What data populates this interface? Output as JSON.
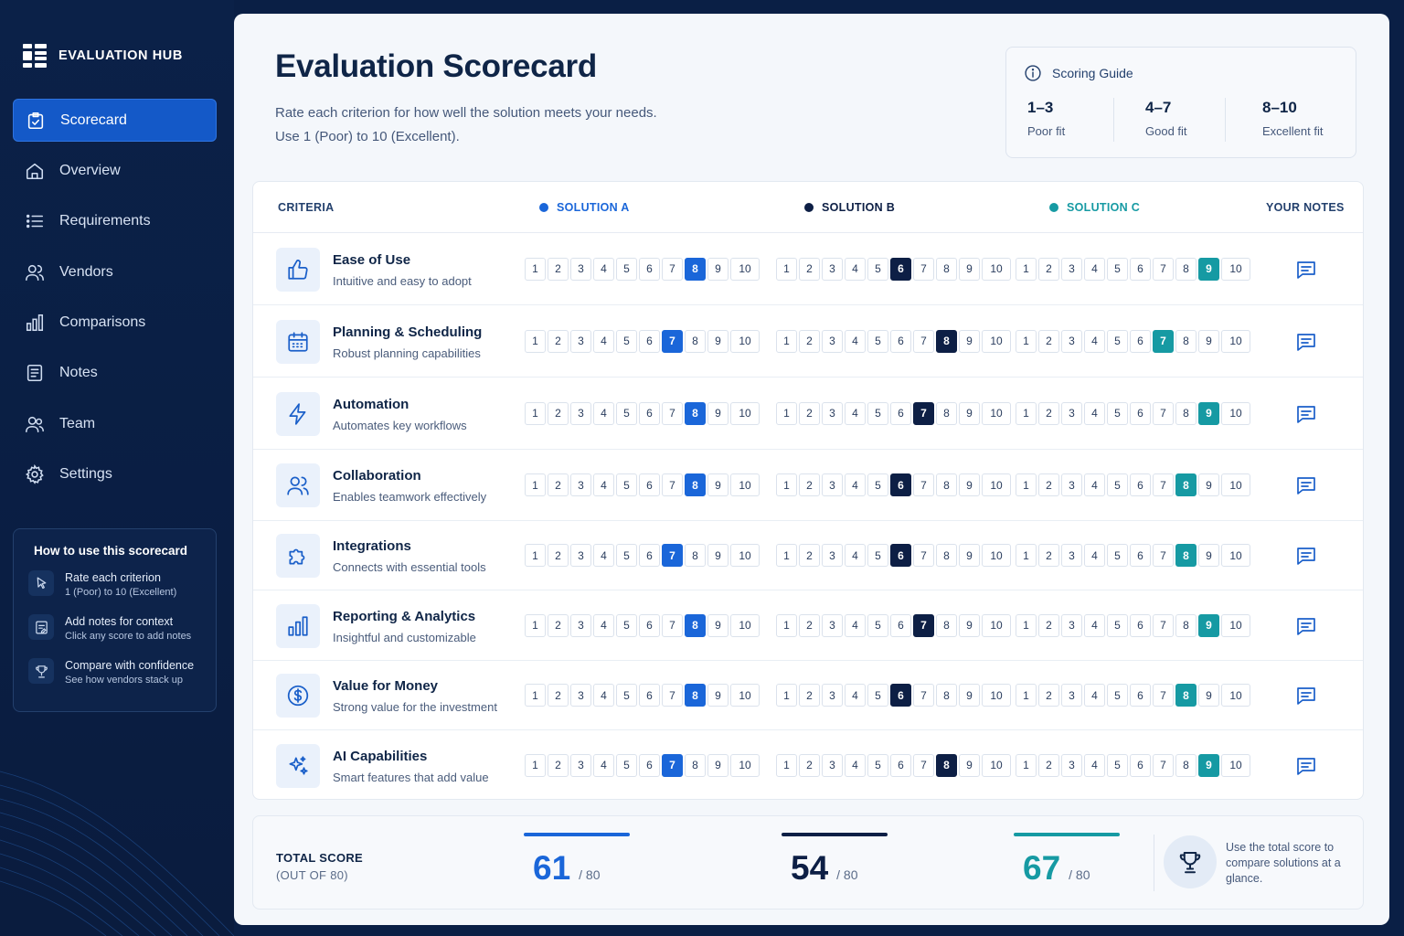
{
  "app": {
    "brand": "EVALUATION HUB"
  },
  "sidebar": {
    "items": [
      {
        "label": "Scorecard",
        "icon": "clipboard-check-icon",
        "active": true
      },
      {
        "label": "Overview",
        "icon": "home-icon"
      },
      {
        "label": "Requirements",
        "icon": "list-icon"
      },
      {
        "label": "Vendors",
        "icon": "users-icon"
      },
      {
        "label": "Comparisons",
        "icon": "bar-chart-icon"
      },
      {
        "label": "Notes",
        "icon": "document-icon"
      },
      {
        "label": "Team",
        "icon": "team-icon"
      },
      {
        "label": "Settings",
        "icon": "gear-icon"
      }
    ],
    "help": {
      "title": "How to use this scorecard",
      "items": [
        {
          "title": "Rate each criterion",
          "desc": "1 (Poor) to 10 (Excellent)",
          "icon": "pointer-click-icon"
        },
        {
          "title": "Add notes for context",
          "desc": "Click any score to add notes",
          "icon": "note-edit-icon"
        },
        {
          "title": "Compare with confidence",
          "desc": "See how vendors stack up",
          "icon": "trophy-icon"
        }
      ]
    }
  },
  "header": {
    "title": "Evaluation Scorecard",
    "subtitle_line1": "Rate each criterion for how well the solution meets your needs.",
    "subtitle_line2": "Use 1 (Poor) to 10 (Excellent)."
  },
  "guide": {
    "title": "Scoring Guide",
    "ranges": [
      {
        "range": "1–3",
        "label": "Poor fit"
      },
      {
        "range": "4–7",
        "label": "Good fit"
      },
      {
        "range": "8–10",
        "label": "Excellent fit"
      }
    ]
  },
  "table": {
    "headers": {
      "criteria": "CRITERIA",
      "a": "SOLUTION A",
      "b": "SOLUTION B",
      "c": "SOLUTION C",
      "notes": "YOUR NOTES"
    },
    "colors": {
      "a": "#1a66d9",
      "b": "#0d1f45",
      "c": "#169aa3"
    },
    "rows": [
      {
        "name": "Ease of Use",
        "desc": "Intuitive and easy to adopt",
        "icon": "thumbs-up-icon",
        "a": 8,
        "b": 6,
        "c": 9
      },
      {
        "name": "Planning & Scheduling",
        "desc": "Robust planning capabilities",
        "icon": "calendar-icon",
        "a": 7,
        "b": 8,
        "c": 7
      },
      {
        "name": "Automation",
        "desc": "Automates key workflows",
        "icon": "lightning-icon",
        "a": 8,
        "b": 7,
        "c": 9
      },
      {
        "name": "Collaboration",
        "desc": "Enables teamwork effectively",
        "icon": "users-icon",
        "a": 8,
        "b": 6,
        "c": 8
      },
      {
        "name": "Integrations",
        "desc": "Connects with essential tools",
        "icon": "puzzle-icon",
        "a": 7,
        "b": 6,
        "c": 8
      },
      {
        "name": "Reporting & Analytics",
        "desc": "Insightful and customizable",
        "icon": "bar-chart-icon",
        "a": 8,
        "b": 7,
        "c": 9
      },
      {
        "name": "Value for Money",
        "desc": "Strong value for the investment",
        "icon": "dollar-icon",
        "a": 8,
        "b": 6,
        "c": 8
      },
      {
        "name": "AI Capabilities",
        "desc": "Smart features that add value",
        "icon": "sparkles-icon",
        "a": 7,
        "b": 8,
        "c": 9
      }
    ]
  },
  "totals": {
    "label_line1": "TOTAL SCORE",
    "label_line2": "(OUT OF 80)",
    "a": "61",
    "b": "54",
    "c": "67",
    "max": "/ 80",
    "tip": "Use the total score to compare solutions at a glance."
  }
}
